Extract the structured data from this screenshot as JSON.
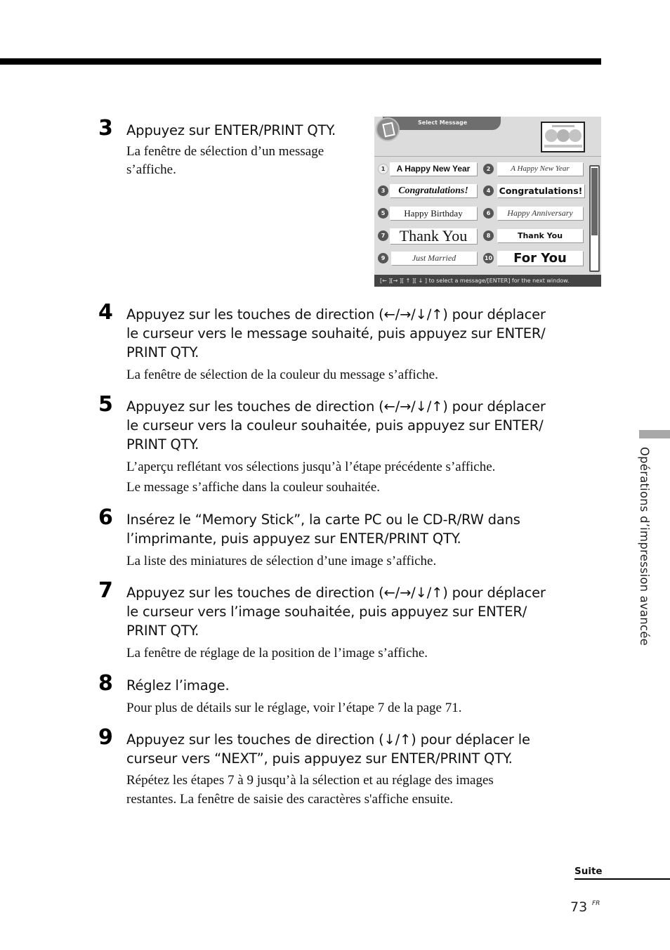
{
  "steps": [
    {
      "num": "3",
      "head": "Appuyez sur ENTER/PRINT QTY.",
      "body": [
        "La fenêtre de sélection d’un message",
        "s’affiche."
      ]
    },
    {
      "num": "4",
      "head_lines": [
        "Appuyez sur les touches de direction (←/→/↓/↑) pour déplacer",
        "le curseur vers le message souhaité, puis appuyez sur ENTER/",
        "PRINT QTY."
      ],
      "body": [
        "La fenêtre de sélection de la couleur du message s’affiche."
      ]
    },
    {
      "num": "5",
      "head_lines": [
        "Appuyez sur les touches de direction (←/→/↓/↑) pour déplacer",
        "le curseur vers la couleur souhaitée, puis appuyez sur ENTER/",
        "PRINT QTY."
      ],
      "body": [
        "L’aperçu reflétant vos sélections jusqu’à l’étape précédente s’affiche.",
        "Le message s’affiche dans la couleur souhaitée."
      ]
    },
    {
      "num": "6",
      "head_lines": [
        "Insérez le “Memory Stick”, la carte PC ou le CD-R/RW dans",
        "l’imprimante, puis appuyez sur ENTER/PRINT QTY."
      ],
      "body": [
        "La liste des miniatures de sélection d’une image s’affiche."
      ]
    },
    {
      "num": "7",
      "head_lines": [
        "Appuyez sur les touches de direction (←/→/↓/↑) pour déplacer",
        "le curseur vers l’image souhaitée, puis appuyez sur ENTER/",
        "PRINT QTY."
      ],
      "body": [
        "La fenêtre de réglage de la position de l’image s’affiche."
      ]
    },
    {
      "num": "8",
      "head_lines": [
        "Réglez l’image."
      ],
      "body": [
        "Pour plus de détails sur le réglage, voir l’étape 7 de la page 71."
      ]
    },
    {
      "num": "9",
      "head_lines": [
        "Appuyez sur les touches de direction (↓/↑) pour déplacer le",
        "curseur vers “NEXT”, puis appuyez sur ENTER/PRINT QTY."
      ],
      "body": [
        "Répétez les étapes 7 à 9 jusqu’à la sélection et au réglage des images",
        "restantes. La fenêtre de saisie des caractères s'affiche ensuite."
      ]
    }
  ],
  "screen": {
    "title": "Select Message",
    "messages": [
      {
        "n": "1",
        "text": "A Happy New Year",
        "selected": true
      },
      {
        "n": "2",
        "text": "A Happy New Year"
      },
      {
        "n": "3",
        "text": "Congratulations!"
      },
      {
        "n": "4",
        "text": "Congratulations!"
      },
      {
        "n": "5",
        "text": "Happy Birthday"
      },
      {
        "n": "6",
        "text": "Happy Anniversary"
      },
      {
        "n": "7",
        "text": "Thank You"
      },
      {
        "n": "8",
        "text": "Thank You"
      },
      {
        "n": "9",
        "text": "Just Married"
      },
      {
        "n": "10",
        "text": "For You"
      }
    ],
    "scroll_position": 0.66,
    "footer": "[← ][→ ][ ↑ ][ ↓ ] to select a message/[ENTER] for the next window."
  },
  "side_label": "Opérations d’impression avancée",
  "suite": "Suite",
  "page_number": "73",
  "page_lang": "FR"
}
